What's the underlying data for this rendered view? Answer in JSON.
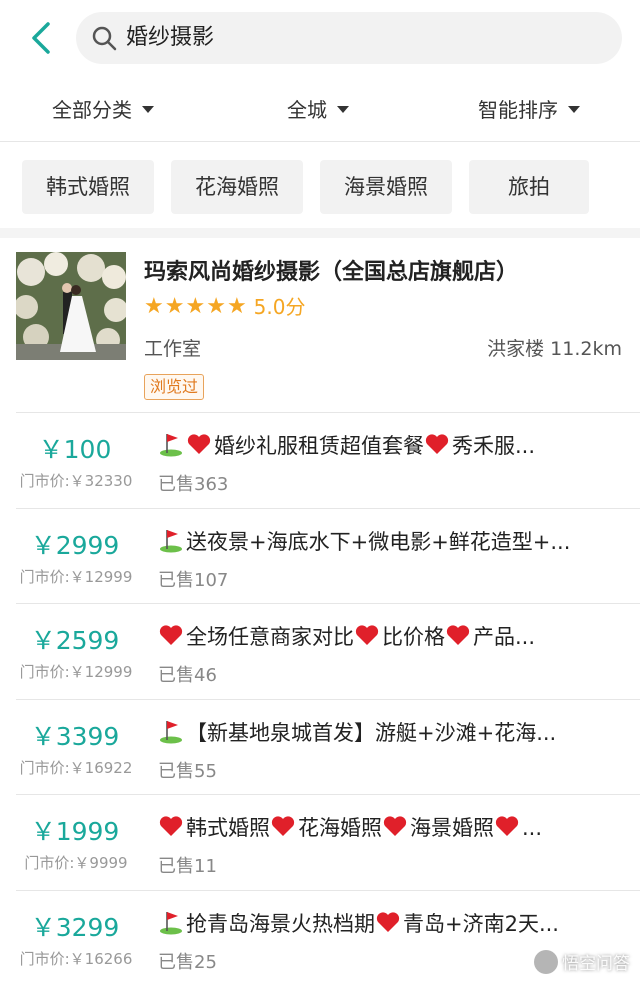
{
  "search": {
    "query": "婚纱摄影"
  },
  "filters": [
    {
      "label": "全部分类"
    },
    {
      "label": "全城"
    },
    {
      "label": "智能排序"
    }
  ],
  "tags": [
    "韩式婚照",
    "花海婚照",
    "海景婚照",
    "旅拍"
  ],
  "shop": {
    "name": "玛索风尚婚纱摄影（全国总店旗舰店）",
    "rating": 5,
    "score": "5.0分",
    "type": "工作室",
    "location": "洪家楼 11.2km",
    "badge": "浏览过"
  },
  "deals": [
    {
      "price": "￥100",
      "original": "门市价:￥32330",
      "title": "婚纱礼服租赁超值套餐",
      "title_suffix": "秀禾服...",
      "sold": "已售363",
      "icons": [
        "golf-flag",
        "heart"
      ]
    },
    {
      "price": "￥2999",
      "original": "门市价:￥12999",
      "title": "送夜景+海底水下+微电影+鲜花造型+...",
      "sold": "已售107",
      "icons": [
        "golf-flag"
      ]
    },
    {
      "price": "￥2599",
      "original": "门市价:￥12999",
      "title": "全场任意商家对比",
      "title_mid": "比价格",
      "title_suffix": "产品...",
      "sold": "已售46",
      "icons": [
        "heart"
      ]
    },
    {
      "price": "￥3399",
      "original": "门市价:￥16922",
      "title": "【新基地泉城首发】游艇+沙滩+花海...",
      "sold": "已售55",
      "icons": [
        "golf-flag"
      ]
    },
    {
      "price": "￥1999",
      "original": "门市价:￥9999",
      "title": "韩式婚照",
      "title_mid": "花海婚照",
      "title_mid2": "海景婚照",
      "title_suffix": "...",
      "sold": "已售11",
      "icons": [
        "heart"
      ]
    },
    {
      "price": "￥3299",
      "original": "门市价:￥16266",
      "title": "抢青岛海景火热档期",
      "title_suffix": "青岛+济南2天...",
      "sold": "已售25",
      "icons": [
        "golf-flag"
      ]
    }
  ],
  "watermark": "悟空问答",
  "colors": {
    "accent": "#1aa89b",
    "star": "#f5a623",
    "badge": "#e07a1f",
    "heart": "#e0202a"
  }
}
